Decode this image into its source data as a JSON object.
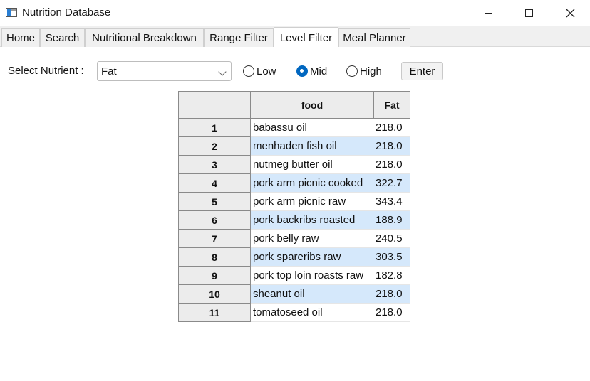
{
  "window": {
    "title": "Nutrition Database"
  },
  "tabs": [
    {
      "label": "Home"
    },
    {
      "label": "Search"
    },
    {
      "label": "Nutritional Breakdown"
    },
    {
      "label": "Range Filter"
    },
    {
      "label": "Level Filter",
      "active": true
    },
    {
      "label": "Meal Planner"
    }
  ],
  "controls": {
    "nutrient_label": "Select Nutrient :",
    "nutrient_selected": "Fat",
    "radios": [
      {
        "label": "Low",
        "checked": false
      },
      {
        "label": "Mid",
        "checked": true
      },
      {
        "label": "High",
        "checked": false
      }
    ],
    "enter_label": "Enter"
  },
  "table": {
    "columns": [
      "",
      "food",
      "Fat"
    ],
    "rows": [
      {
        "index": "1",
        "food": "babassu oil",
        "value": "218.0"
      },
      {
        "index": "2",
        "food": "menhaden fish oil",
        "value": "218.0"
      },
      {
        "index": "3",
        "food": "nutmeg butter oil",
        "value": "218.0"
      },
      {
        "index": "4",
        "food": "pork arm picnic cooked",
        "value": "322.7"
      },
      {
        "index": "5",
        "food": "pork arm picnic raw",
        "value": "343.4"
      },
      {
        "index": "6",
        "food": "pork backribs roasted",
        "value": "188.9"
      },
      {
        "index": "7",
        "food": "pork belly raw",
        "value": "240.5"
      },
      {
        "index": "8",
        "food": "pork spareribs raw",
        "value": "303.5"
      },
      {
        "index": "9",
        "food": "pork top loin roasts raw",
        "value": "182.8"
      },
      {
        "index": "10",
        "food": "sheanut oil",
        "value": "218.0"
      },
      {
        "index": "11",
        "food": "tomatoseed oil",
        "value": "218.0"
      }
    ]
  },
  "colors": {
    "row_highlight": "#d5e8fb",
    "radio_accent": "#0067c0",
    "header_bg": "#ececec"
  }
}
